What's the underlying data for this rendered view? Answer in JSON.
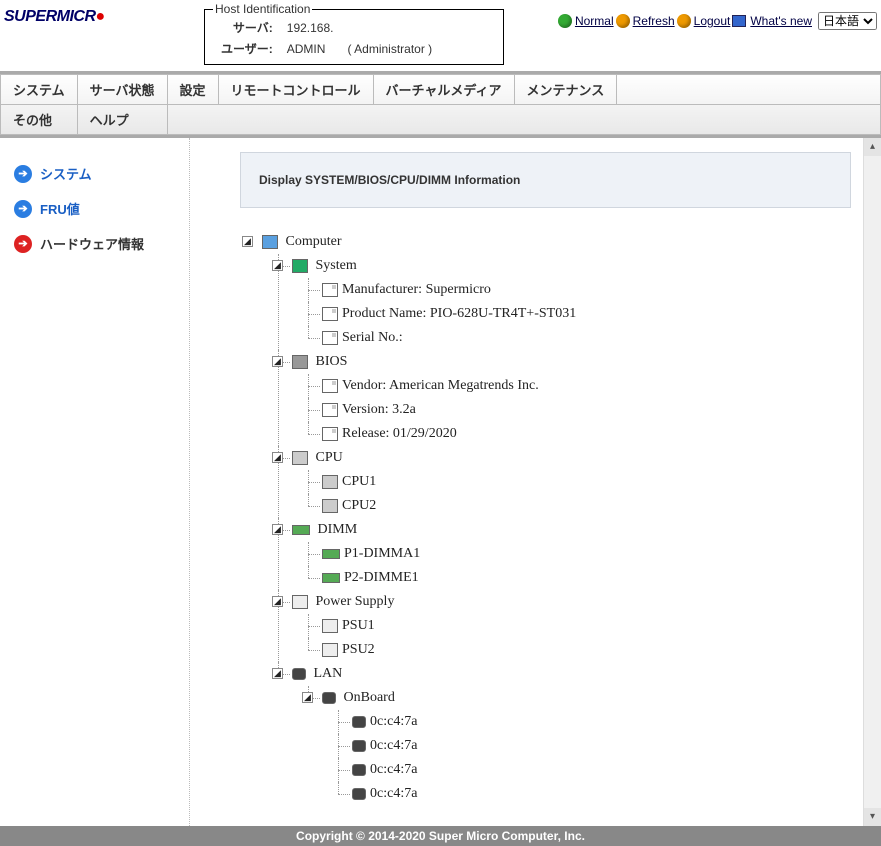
{
  "header": {
    "logo_text": "SUPERMICR",
    "host_legend": "Host Identification",
    "server_label": "サーバ:",
    "server_value": "192.168.",
    "user_label": "ユーザー:",
    "user_value": "ADMIN",
    "user_role": "( Administrator )",
    "links": {
      "normal": "Normal",
      "refresh": "Refresh",
      "logout": "Logout",
      "whatsnew": "What's new"
    },
    "lang_selected": "日本語"
  },
  "menu": {
    "row1": [
      "システム",
      "サーバ状態",
      "設定",
      "リモートコントロール",
      "バーチャルメディア",
      "メンテナンス"
    ],
    "row2": [
      "その他",
      "ヘルプ"
    ]
  },
  "sidebar": [
    {
      "label": "システム",
      "active": false
    },
    {
      "label": "FRU値",
      "active": false
    },
    {
      "label": "ハードウェア情報",
      "active": true
    }
  ],
  "banner": "Display SYSTEM/BIOS/CPU/DIMM Information",
  "tree": {
    "root": "Computer",
    "system": {
      "label": "System",
      "manufacturer": "Manufacturer: Supermicro",
      "product": "Product Name: PIO-628U-TR4T+-ST031",
      "serial": "Serial No.:"
    },
    "bios": {
      "label": "BIOS",
      "vendor": "Vendor: American Megatrends Inc.",
      "version": "Version: 3.2a",
      "release": "Release: 01/29/2020"
    },
    "cpu": {
      "label": "CPU",
      "items": [
        "CPU1",
        "CPU2"
      ]
    },
    "dimm": {
      "label": "DIMM",
      "items": [
        "P1-DIMMA1",
        "P2-DIMME1"
      ]
    },
    "psu": {
      "label": "Power Supply",
      "items": [
        "PSU1",
        "PSU2"
      ]
    },
    "lan": {
      "label": "LAN",
      "onboard": "OnBoard",
      "macs": [
        "0c:c4:7a",
        "0c:c4:7a",
        "0c:c4:7a",
        "0c:c4:7a"
      ]
    }
  },
  "footer": "Copyright © 2014-2020 Super Micro Computer, Inc."
}
